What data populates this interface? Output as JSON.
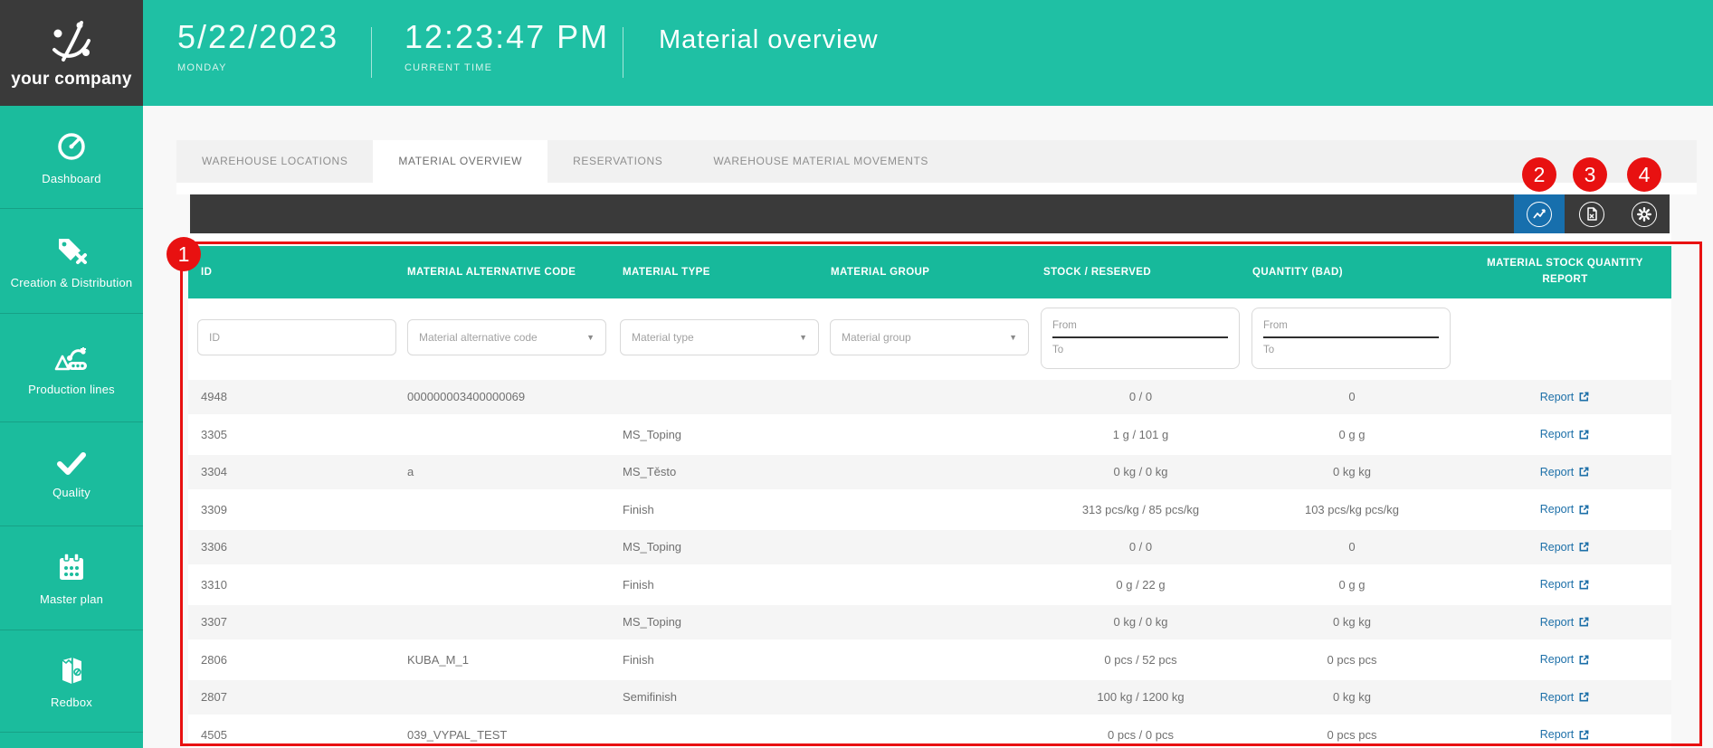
{
  "colors": {
    "teal": "#1bbc9d",
    "dark": "#3a3a3a",
    "red": "#e81111",
    "blue_active": "#176fad",
    "link_blue": "#1c6fa8"
  },
  "header": {
    "logo_text": "your company",
    "date": "5/22/2023",
    "date_label": "MONDAY",
    "time": "12:23:47 PM",
    "time_label": "CURRENT TIME",
    "title": "Material overview"
  },
  "sidebar": {
    "items": [
      {
        "label": "Dashboard",
        "icon": "gauge-icon"
      },
      {
        "label": "Creation & Distribution",
        "icon": "tag-icon"
      },
      {
        "label": "Production lines",
        "icon": "conveyor-icon"
      },
      {
        "label": "Quality",
        "icon": "check-icon"
      },
      {
        "label": "Master plan",
        "icon": "calendar-icon"
      },
      {
        "label": "Redbox",
        "icon": "box-icon"
      }
    ]
  },
  "tabs": [
    {
      "label": "WAREHOUSE LOCATIONS",
      "active": false
    },
    {
      "label": "MATERIAL OVERVIEW",
      "active": true
    },
    {
      "label": "RESERVATIONS",
      "active": false
    },
    {
      "label": "WAREHOUSE MATERIAL MOVEMENTS",
      "active": false
    }
  ],
  "toolbar": {
    "buttons": [
      {
        "name": "chart-report",
        "icon": "line-chart-icon",
        "active": true
      },
      {
        "name": "document",
        "icon": "document-icon",
        "active": false
      },
      {
        "name": "settings",
        "icon": "gear-icon",
        "active": false
      }
    ]
  },
  "annotations": {
    "badges": [
      "1",
      "2",
      "3",
      "4"
    ]
  },
  "table": {
    "columns": [
      "ID",
      "MATERIAL ALTERNATIVE CODE",
      "MATERIAL TYPE",
      "MATERIAL GROUP",
      "STOCK / RESERVED",
      "QUANTITY (BAD)",
      "MATERIAL STOCK QUANTITY REPORT"
    ],
    "filters": {
      "id": "ID",
      "alt_code": "Material alternative code",
      "type": "Material type",
      "group": "Material group",
      "from": "From",
      "to": "To"
    },
    "report_label": "Report",
    "rows": [
      {
        "id": "4948",
        "alt": "000000003400000069",
        "type": "",
        "group": "",
        "stock": "0 / 0",
        "bad": "0"
      },
      {
        "id": "3305",
        "alt": "",
        "type": "MS_Toping",
        "group": "",
        "stock": "1 g / 101 g",
        "bad": "0 g g"
      },
      {
        "id": "3304",
        "alt": "a",
        "type": "MS_Těsto",
        "group": "",
        "stock": "0 kg / 0 kg",
        "bad": "0 kg kg"
      },
      {
        "id": "3309",
        "alt": "",
        "type": "Finish",
        "group": "",
        "stock": "313 pcs/kg / 85 pcs/kg",
        "bad": "103 pcs/kg pcs/kg"
      },
      {
        "id": "3306",
        "alt": "",
        "type": "MS_Toping",
        "group": "",
        "stock": "0 / 0",
        "bad": "0"
      },
      {
        "id": "3310",
        "alt": "",
        "type": "Finish",
        "group": "",
        "stock": "0 g / 22 g",
        "bad": "0 g g"
      },
      {
        "id": "3307",
        "alt": "",
        "type": "MS_Toping",
        "group": "",
        "stock": "0 kg / 0 kg",
        "bad": "0 kg kg"
      },
      {
        "id": "2806",
        "alt": "KUBA_M_1",
        "type": "Finish",
        "group": "",
        "stock": "0 pcs / 52 pcs",
        "bad": "0 pcs pcs"
      },
      {
        "id": "2807",
        "alt": "",
        "type": "Semifinish",
        "group": "",
        "stock": "100 kg / 1200 kg",
        "bad": "0 kg kg"
      },
      {
        "id": "4505",
        "alt": "039_VYPAL_TEST",
        "type": "",
        "group": "",
        "stock": "0 pcs / 0 pcs",
        "bad": "0 pcs pcs"
      }
    ]
  }
}
